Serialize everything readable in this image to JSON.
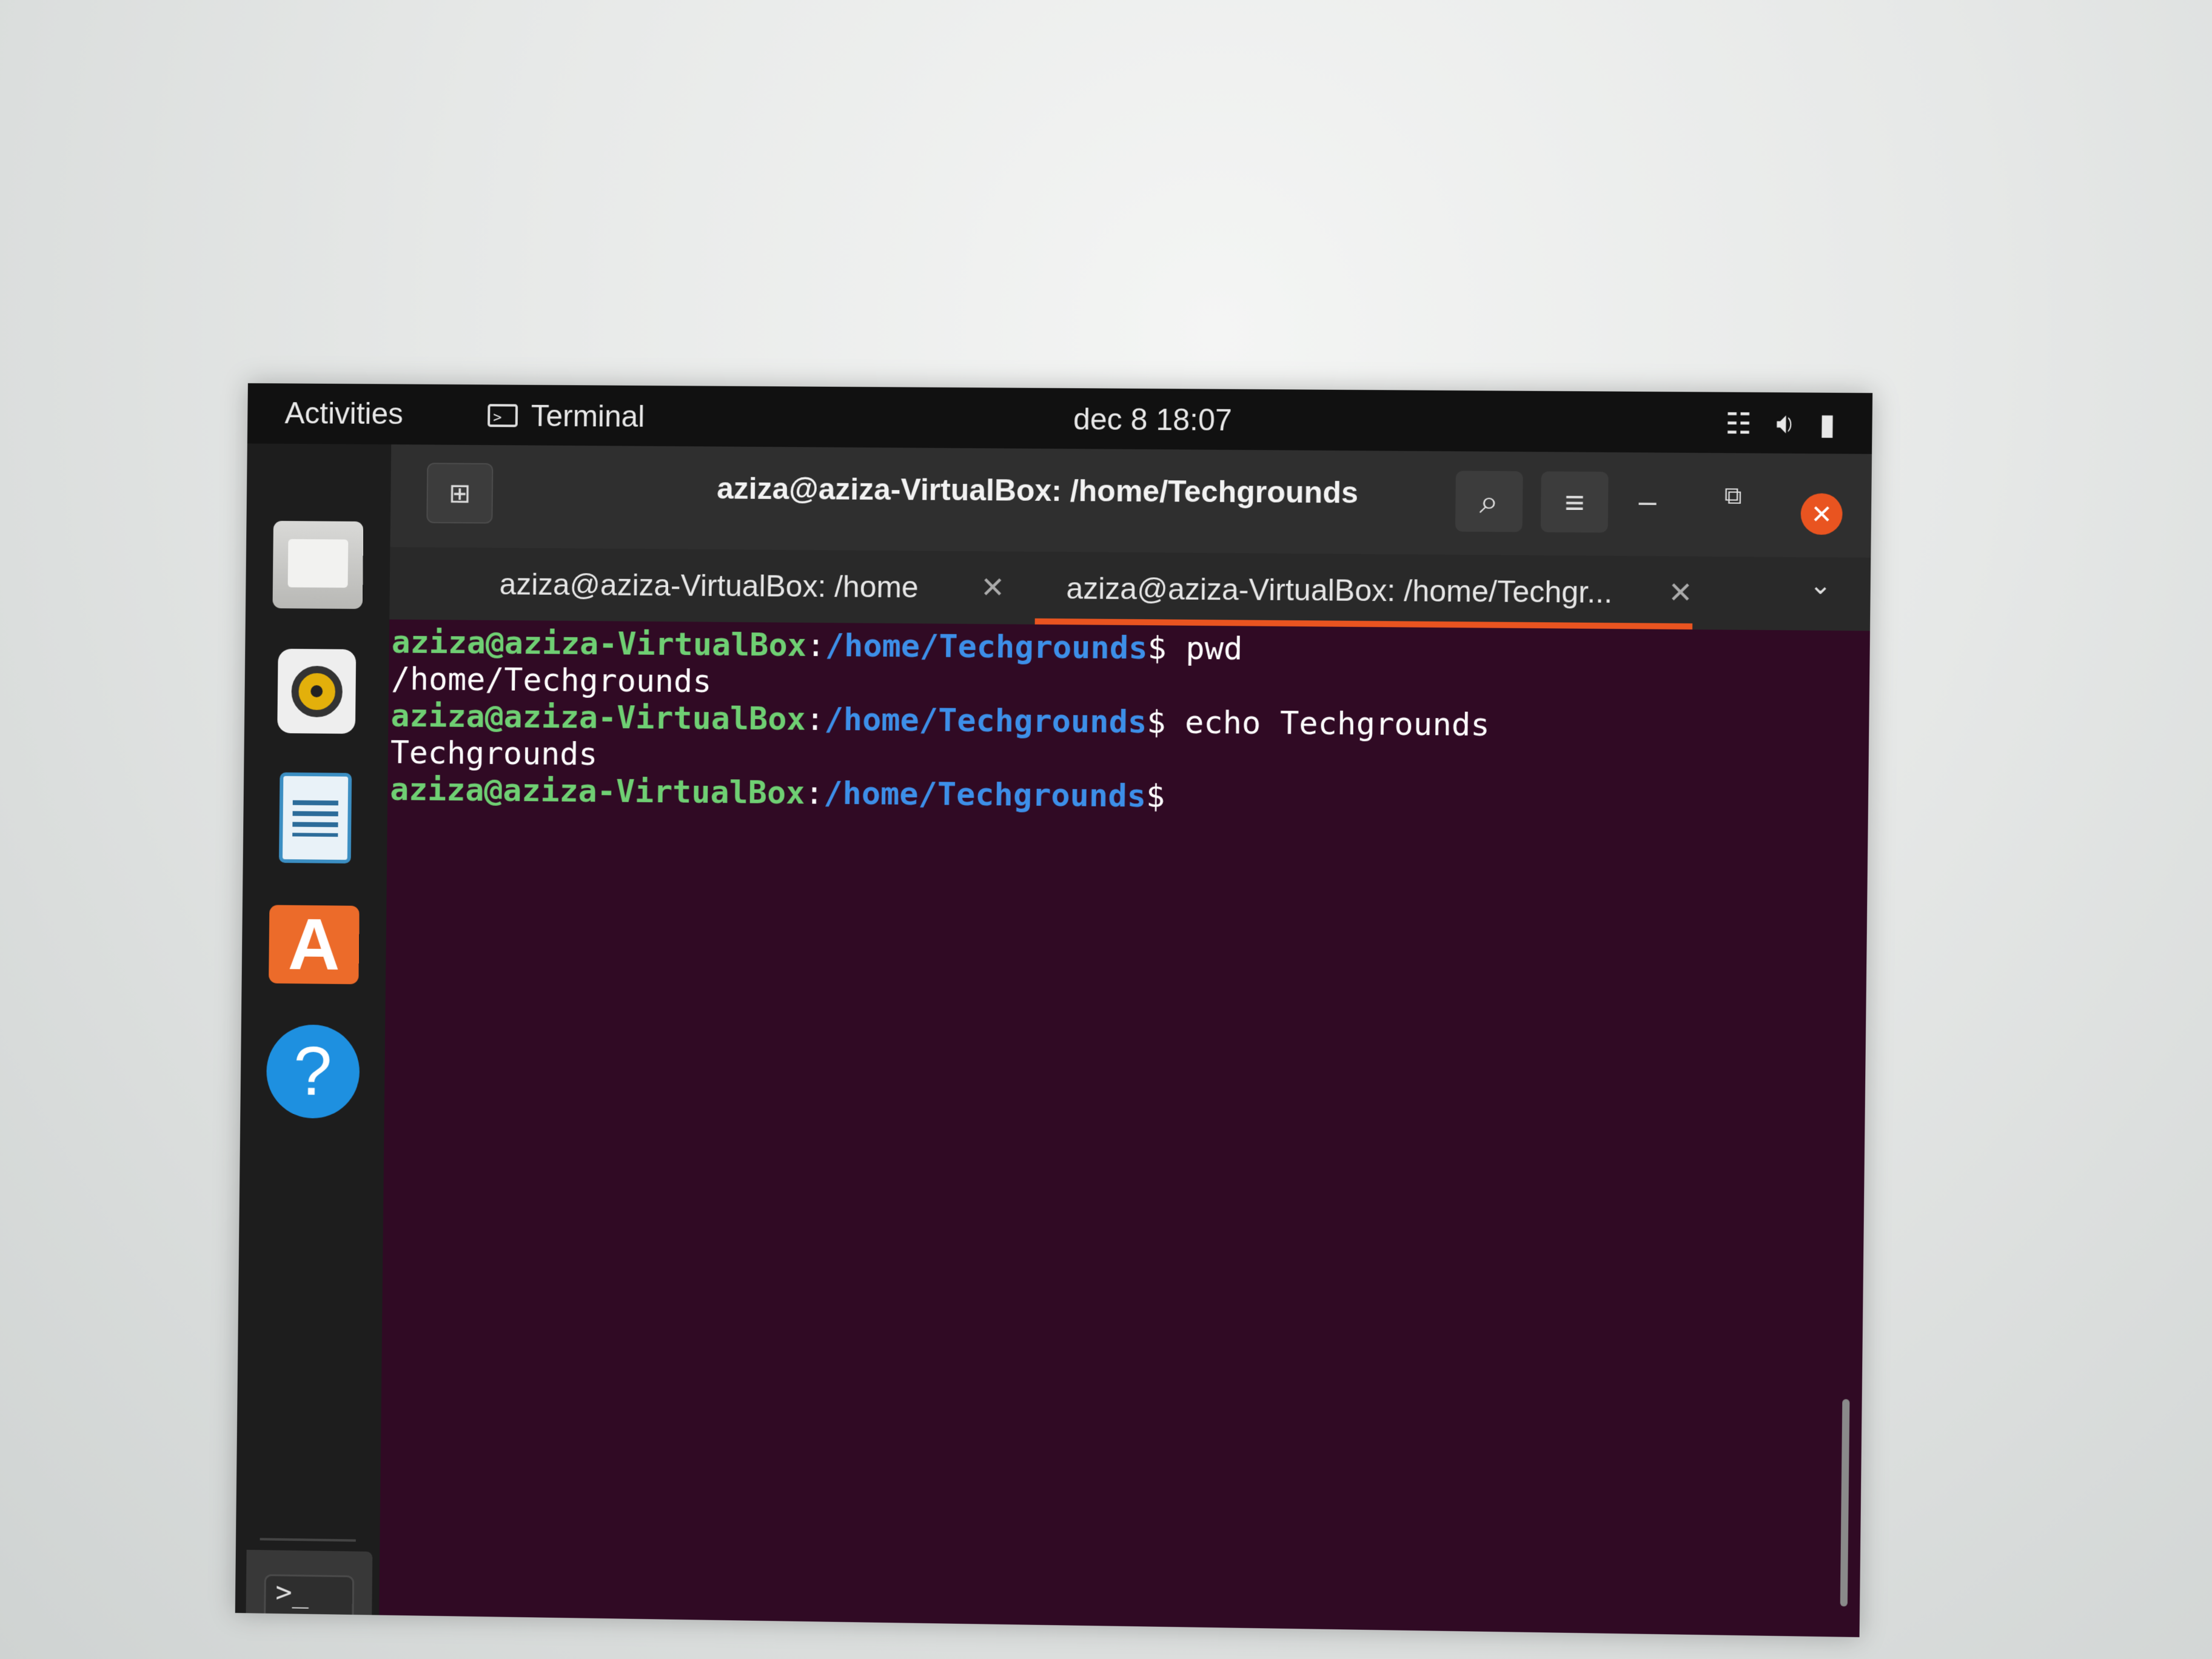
{
  "topbar": {
    "activities": "Activities",
    "app_name": "Terminal",
    "clock": "dec 8  18:07"
  },
  "window": {
    "title": "aziza@aziza-VirtualBox: /home/Techgrounds",
    "tabs": [
      {
        "label": "aziza@aziza-VirtualBox: /home",
        "active": false
      },
      {
        "label": "aziza@aziza-VirtualBox: /home/Techgr...",
        "active": true
      }
    ]
  },
  "terminal": {
    "lines": [
      {
        "user": "aziza@aziza-VirtualBox",
        "colon": ":",
        "path": "/home/Techgrounds",
        "prompt": "$",
        "command": " pwd"
      },
      {
        "output": "/home/Techgrounds"
      },
      {
        "user": "aziza@aziza-VirtualBox",
        "colon": ":",
        "path": "/home/Techgrounds",
        "prompt": "$",
        "command": " echo Techgrounds"
      },
      {
        "output": "Techgrounds"
      },
      {
        "user": "aziza@aziza-VirtualBox",
        "colon": ":",
        "path": "/home/Techgrounds",
        "prompt": "$",
        "command": ""
      }
    ]
  },
  "icons": {
    "app_menu": "terminal-icon",
    "tray": [
      "network-icon",
      "volume-icon",
      "battery-icon"
    ],
    "dock": [
      "files-icon",
      "rhythmbox-icon",
      "writer-icon",
      "software-icon",
      "help-icon",
      "terminal-icon",
      "ubuntu-icon",
      "drive-icon",
      "app-grid-icon"
    ]
  },
  "colors": {
    "accent": "#e95420",
    "terminal_bg": "#300a24",
    "prompt_user": "#6fcf73",
    "prompt_path": "#3d8fe8"
  }
}
